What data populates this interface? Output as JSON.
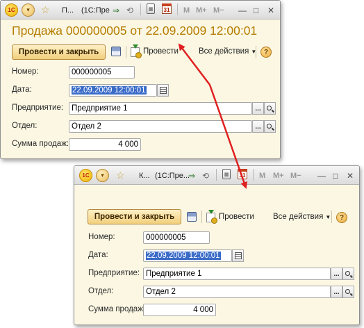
{
  "windows": [
    {
      "title_short": "П...",
      "title_app": "(1С:Пре",
      "doc_title": "Продажа 000000005 от 22.09.2009 12:00:01",
      "toolbar": {
        "post_close": "Провести и закрыть",
        "post": "Провести",
        "all_actions": "Все действия",
        "help": "?"
      },
      "fields": {
        "number": {
          "label": "Номер:",
          "value": "000000005"
        },
        "date": {
          "label": "Дата:",
          "value": "22.09.2009 12:00:01"
        },
        "company": {
          "label": "Предприятие:",
          "value": "Предприятие 1"
        },
        "department": {
          "label": "Отдел:",
          "value": "Отдел 2"
        },
        "sales_sum": {
          "label": "Сумма продаж:",
          "value": "4 000"
        }
      }
    },
    {
      "title_short": "К...",
      "title_app": "(1С:Пре...",
      "toolbar": {
        "post_close": "Провести и закрыть",
        "post": "Провести",
        "all_actions": "Все действия",
        "help": "?"
      },
      "fields": {
        "number": {
          "label": "Номер:",
          "value": "000000005"
        },
        "date": {
          "label": "Дата:",
          "value": "22.09.2009 12:00:01"
        },
        "company": {
          "label": "Предприятие:",
          "value": "Предприятие 1"
        },
        "department": {
          "label": "Отдел:",
          "value": "Отдел 2"
        },
        "sales_sum": {
          "label": "Сумма продаж:",
          "value": "4 000"
        }
      }
    }
  ],
  "titlebar_glyphs": {
    "logo": "1С",
    "m": "M",
    "m_plus": "M+",
    "m_minus": "M−",
    "minimize": "—",
    "maximize": "□",
    "close": "✕",
    "ellipsis": "..."
  },
  "colors": {
    "doc_title": "#b57c00",
    "arrow": "#e02020",
    "window_bg": "#fbf7e3",
    "selection": "#3a6bc8"
  },
  "icons": [
    "logo-1c-icon",
    "dropdown-menu-icon",
    "favorite-star-icon",
    "go-forward-icon",
    "calculator-icon",
    "calendar-icon",
    "save-icon",
    "post-document-icon",
    "help-icon",
    "magnifier-icon"
  ]
}
